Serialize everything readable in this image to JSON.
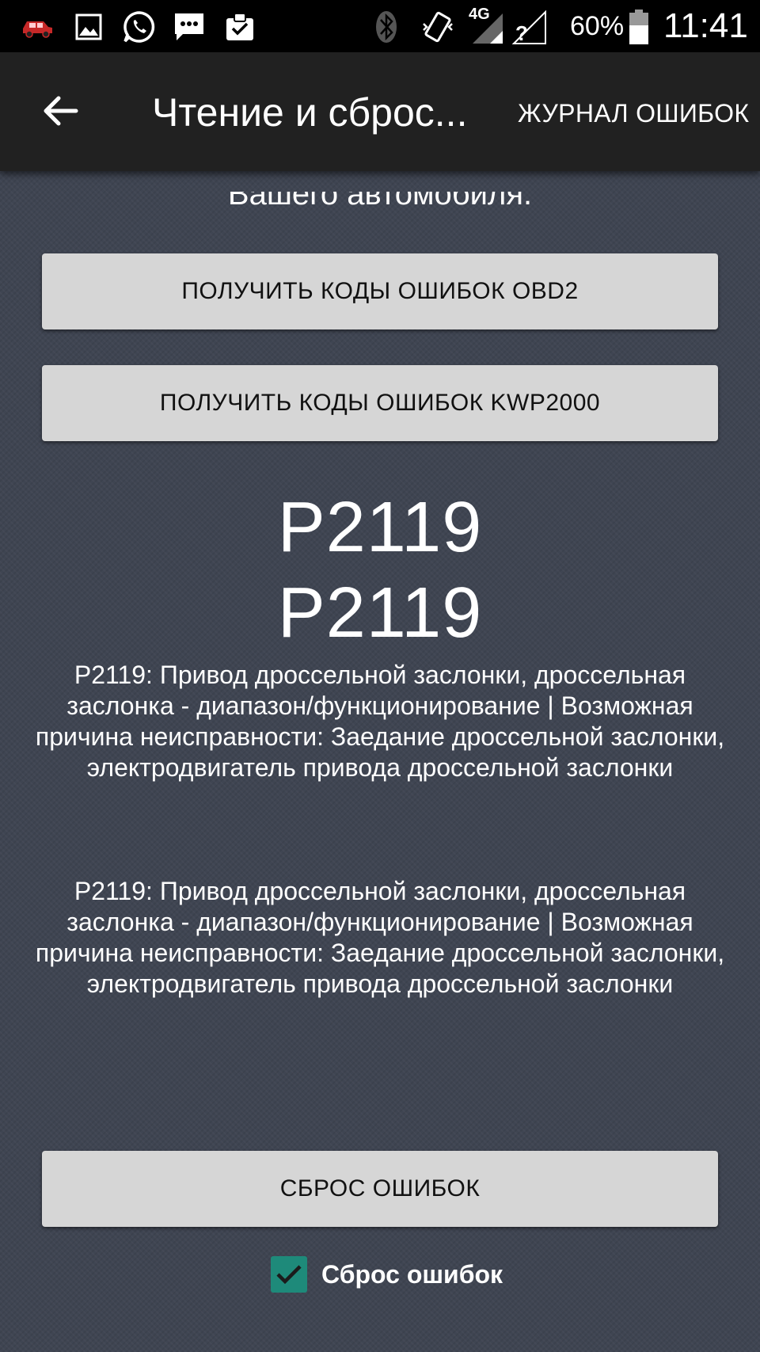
{
  "status_bar": {
    "battery": "60%",
    "time": "11:41",
    "network": "4G",
    "icons": [
      "car-icon",
      "image-icon",
      "whatsapp-icon",
      "sms-icon",
      "clipboard-check-icon",
      "bluetooth-icon",
      "vibrate-icon",
      "signal-icon",
      "no-sim-icon",
      "battery-icon"
    ]
  },
  "app_bar": {
    "title": "Чтение и сброс...",
    "action": "ЖУРНАЛ ОШИБОК"
  },
  "content": {
    "intro": "Вашего автомобиля.",
    "obd2_button": "ПОЛУЧИТЬ КОДЫ ОШИБОК OBD2",
    "kwp_button": "ПОЛУЧИТЬ КОДЫ ОШИБОК KWP2000",
    "codes": [
      "P2119",
      "P2119"
    ],
    "descriptions": [
      "P2119: Привод дроссельной заслонки, дроссельная заслонка - диапазон/функционирование | Возможная причина неисправности: Заедание дроссельной заслонки, электродвигатель привода дроссельной заслонки",
      "P2119: Привод дроссельной заслонки, дроссельная заслонка - диапазон/функционирование | Возможная причина неисправности: Заедание дроссельной заслонки, электродвигатель привода дроссельной заслонки"
    ],
    "reset_button": "СБРОС ОШИБОК",
    "reset_checkbox": {
      "label": "Сброс ошибок",
      "checked": true
    }
  },
  "colors": {
    "status_bar": "#000000",
    "app_bar": "#212121",
    "background": "#3f4552",
    "button": "#d6d6d6",
    "accent": "#1e8a7a"
  }
}
